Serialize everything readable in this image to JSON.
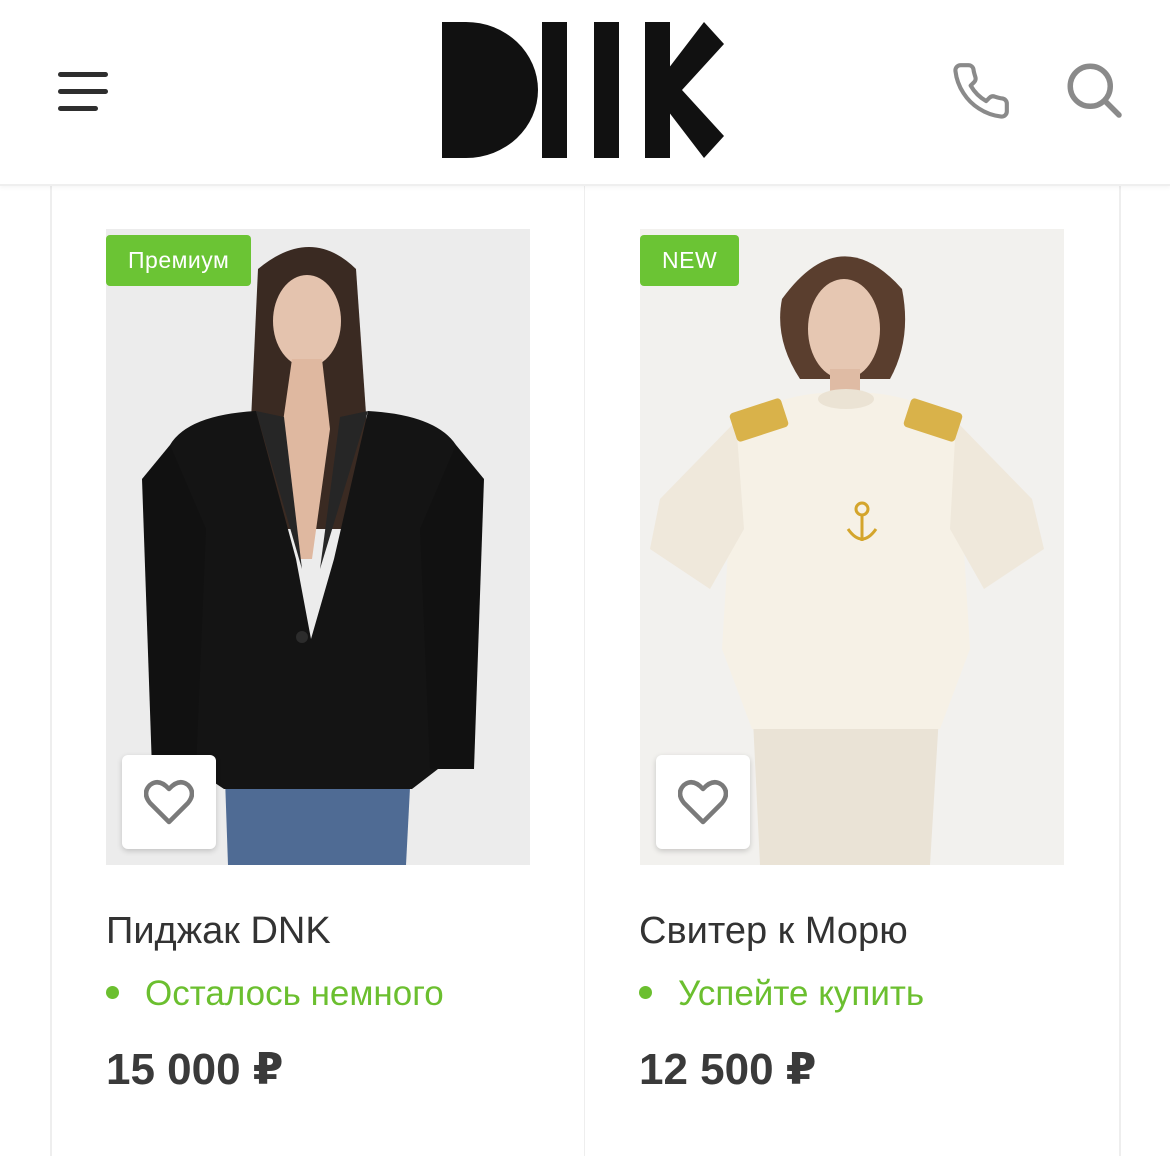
{
  "header": {
    "logo_text": "DNK",
    "menu_icon": "menu-icon",
    "phone_icon": "phone-icon",
    "search_icon": "search-icon"
  },
  "products": [
    {
      "badge": "Премиум",
      "title": "Пиджак DNK",
      "stock": "Осталось немного",
      "price": "15 000 ₽",
      "favorite_icon": "heart-icon"
    },
    {
      "badge": "NEW",
      "title": "Свитер к Морю",
      "stock": "Успейте купить",
      "price": "12 500 ₽",
      "favorite_icon": "heart-icon"
    }
  ],
  "colors": {
    "badge": "#6bc434",
    "stock": "#6bbf2f",
    "text": "#333333",
    "icons": "#8a8a8a"
  }
}
